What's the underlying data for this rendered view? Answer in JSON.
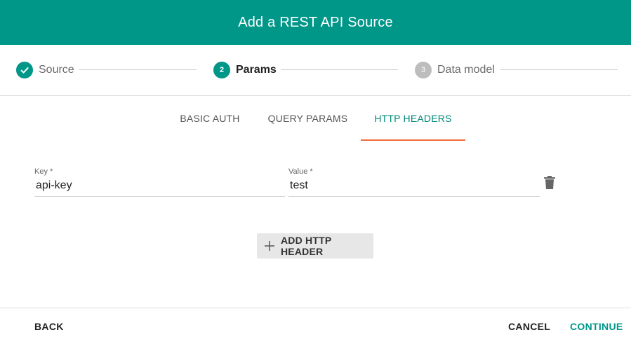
{
  "header": {
    "title": "Add a REST API Source"
  },
  "stepper": {
    "steps": [
      {
        "label": "Source",
        "number": "",
        "state": "done"
      },
      {
        "label": "Params",
        "number": "2",
        "state": "active"
      },
      {
        "label": "Data model",
        "number": "3",
        "state": "pending"
      }
    ]
  },
  "tabs": [
    {
      "label": "BASIC AUTH"
    },
    {
      "label": "QUERY PARAMS"
    },
    {
      "label": "HTTP HEADERS",
      "active": true
    }
  ],
  "form": {
    "key_label": "Key *",
    "key_value": "api-key",
    "value_label": "Value *",
    "value_value": "test",
    "delete_icon": "trash-icon",
    "add_button_label": "ADD HTTP HEADER",
    "add_icon": "plus-icon"
  },
  "footer": {
    "back_label": "BACK",
    "cancel_label": "CANCEL",
    "continue_label": "CONTINUE"
  },
  "colors": {
    "primary": "#009688",
    "tab_indicator": "#f26b3a",
    "pending_step": "#bdbdbd"
  }
}
